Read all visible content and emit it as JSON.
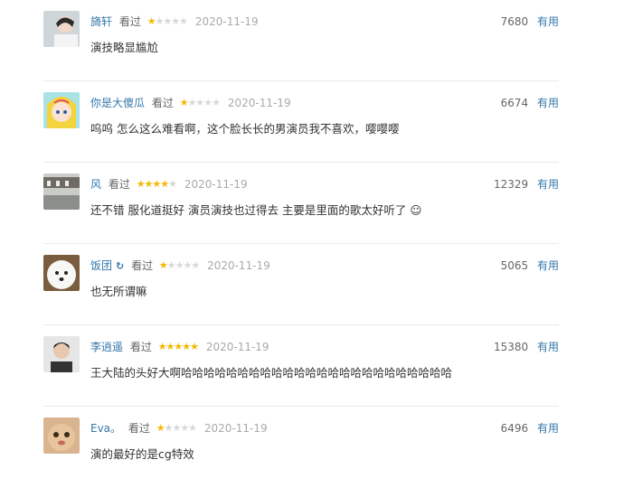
{
  "comments": [
    {
      "user": "旖轩",
      "status": "看过",
      "stars": 1,
      "time": "2020-11-19",
      "votes": "7680",
      "vote_label": "有用",
      "text": "演技略显尴尬"
    },
    {
      "user": "你是大傻瓜",
      "status": "看过",
      "stars": 1,
      "time": "2020-11-19",
      "votes": "6674",
      "vote_label": "有用",
      "text": "呜呜 怎么这么难看啊，这个脸长长的男演员我不喜欢，嘤嘤嘤"
    },
    {
      "user": "风",
      "status": "看过",
      "stars": 4,
      "time": "2020-11-19",
      "votes": "12329",
      "vote_label": "有用",
      "text": "还不错 服化道挺好 演员演技也过得去 主要是里面的歌太好听了 ☺"
    },
    {
      "user": "饭团",
      "status": "看过",
      "stars": 1,
      "time": "2020-11-19",
      "votes": "5065",
      "vote_label": "有用",
      "text": "也无所谓嘛"
    },
    {
      "user": "李逍遥",
      "status": "看过",
      "stars": 5,
      "time": "2020-11-19",
      "votes": "15380",
      "vote_label": "有用",
      "text": "王大陆的头好大啊哈哈哈哈哈哈哈哈哈哈哈哈哈哈哈哈哈哈哈哈哈哈哈哈"
    },
    {
      "user": "Eva。",
      "status": "看过",
      "stars": 1,
      "time": "2020-11-19",
      "votes": "6496",
      "vote_label": "有用",
      "text": "演的最好的是cg特效"
    }
  ],
  "colors": {
    "link": "#3377aa",
    "star": "#f6b800",
    "star_empty": "#d8d8d8",
    "divider": "#e9e9e9"
  },
  "icons": {
    "verified": "verified-badge-icon"
  }
}
